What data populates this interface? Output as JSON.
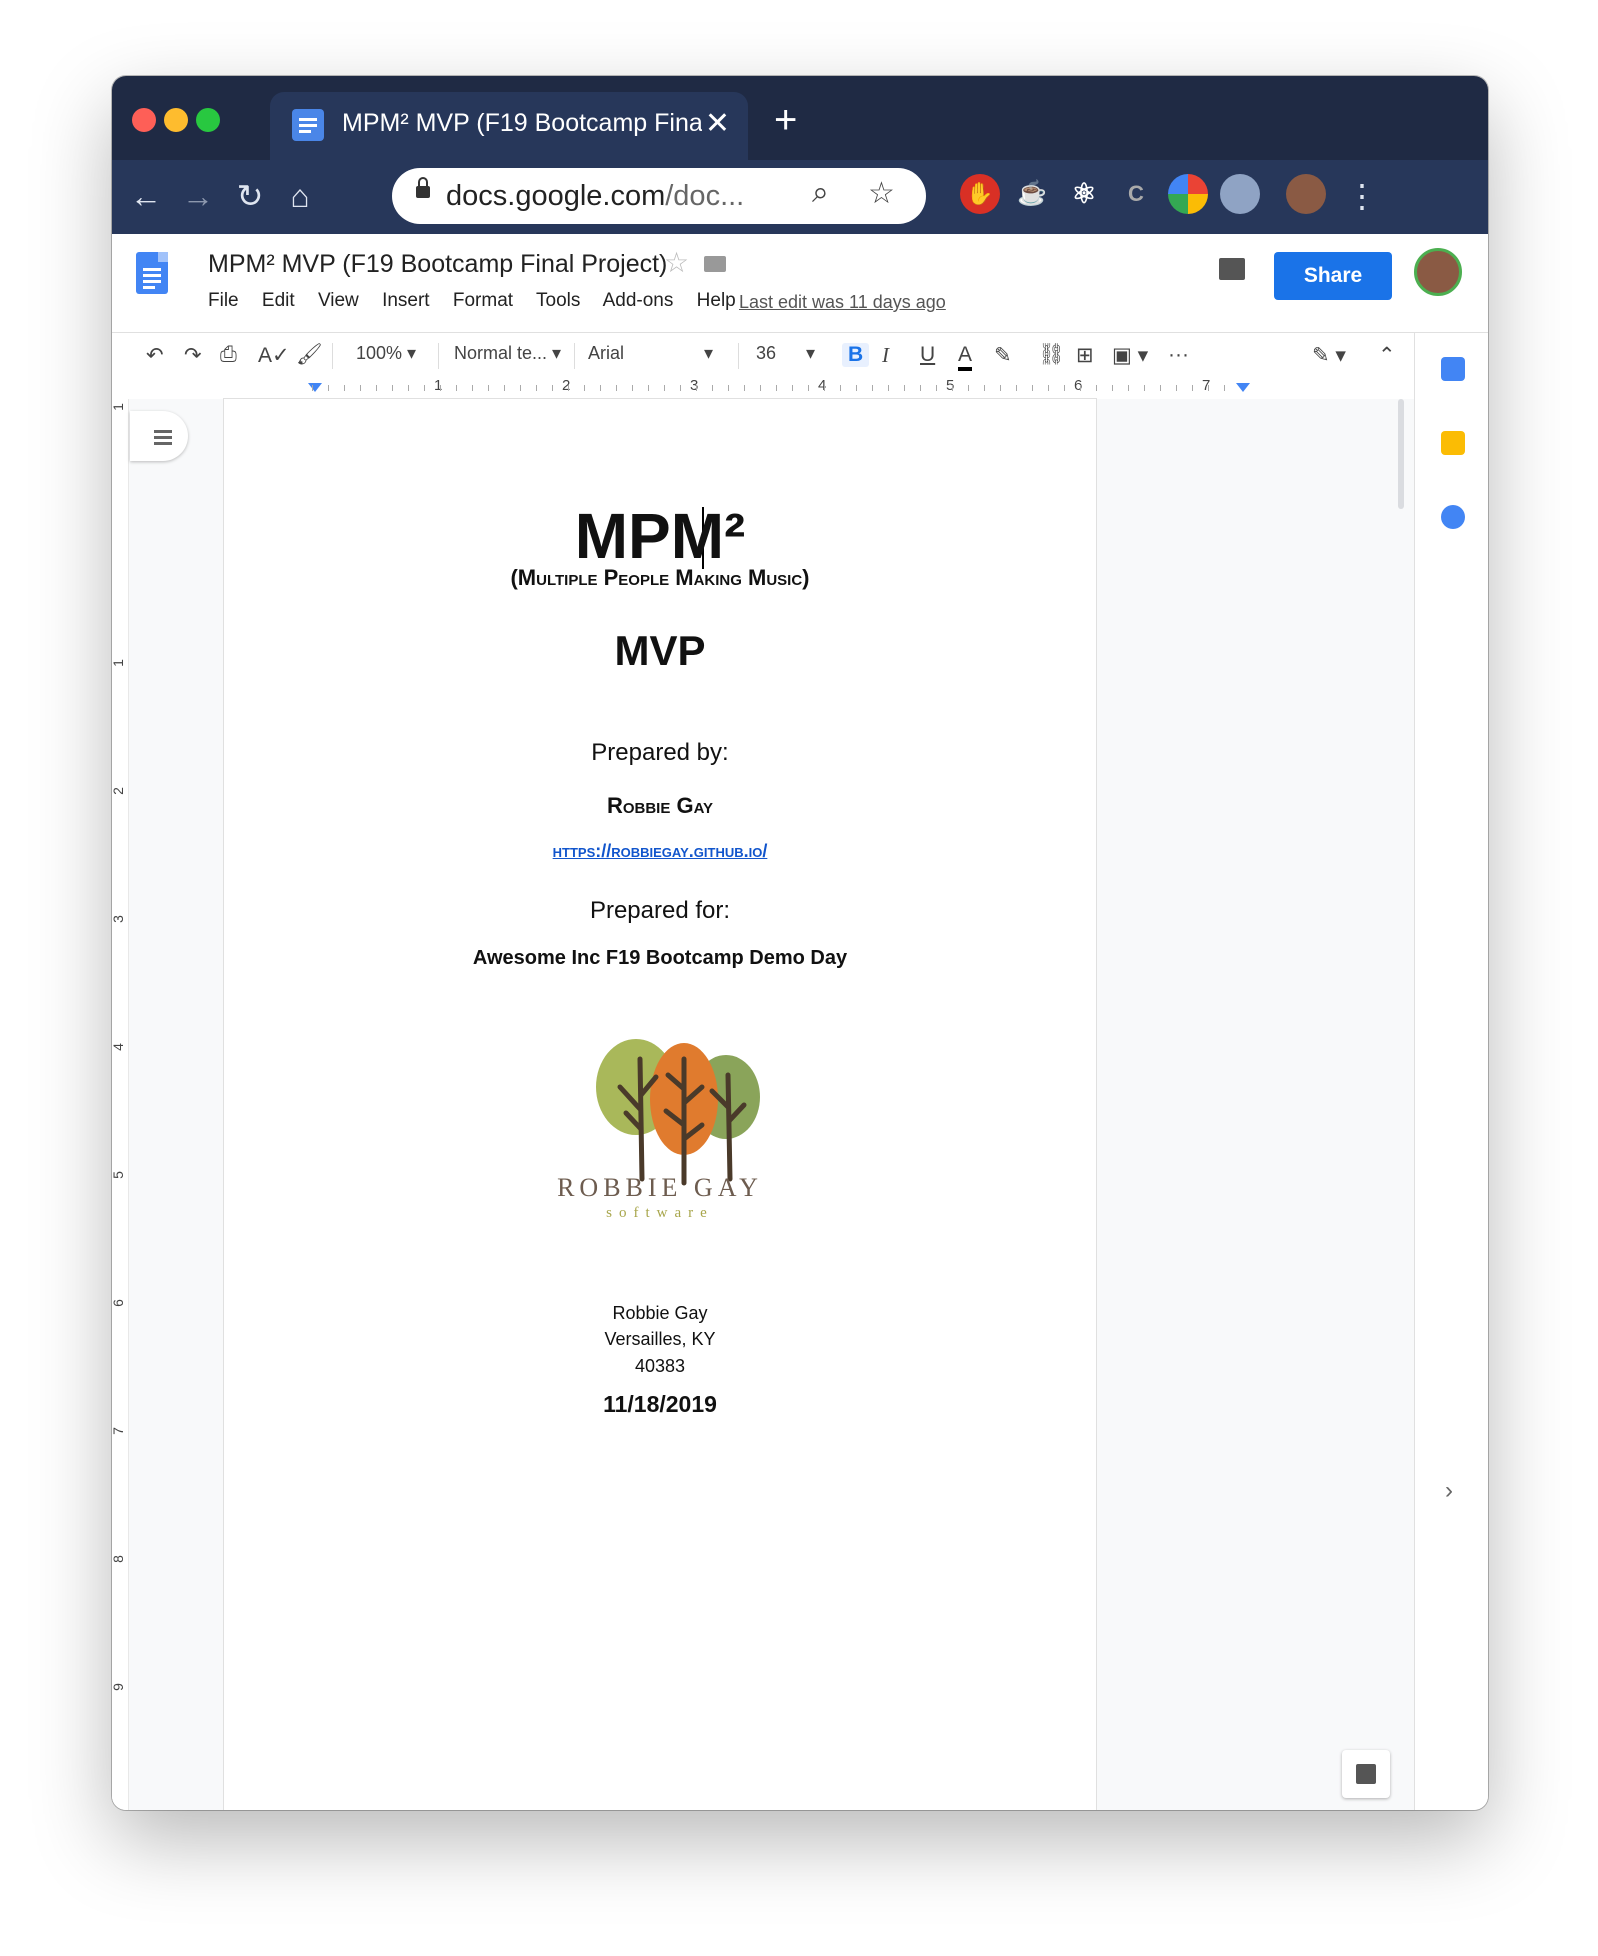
{
  "browser": {
    "tab_title": "MPM² MVP (F19 Bootcamp Fina",
    "tab_close": "✕",
    "new_tab": "+",
    "url_main": "docs.google.com",
    "url_rest": "/doc...",
    "nav": {
      "back": "←",
      "forward": "→",
      "reload": "↻",
      "home": "⌂",
      "menu": "⋮"
    }
  },
  "docs": {
    "title": "MPM² MVP (F19 Bootcamp Final Project)",
    "menu": [
      "File",
      "Edit",
      "View",
      "Insert",
      "Format",
      "Tools",
      "Add-ons",
      "Help"
    ],
    "last_edit": "Last edit was 11 days ago",
    "share_label": "Share"
  },
  "toolbar": {
    "zoom": "100%",
    "style": "Normal te...",
    "font": "Arial",
    "size": "36",
    "bold": "B",
    "italic": "I",
    "underline": "U",
    "text_color": "A",
    "more": "···"
  },
  "ruler": {
    "numbers": [
      "1",
      "2",
      "3",
      "4",
      "5",
      "6",
      "7"
    ],
    "vnumbers": [
      "1",
      "1",
      "2",
      "3",
      "4",
      "5",
      "6",
      "7",
      "8",
      "9"
    ]
  },
  "document": {
    "title": "MPM²",
    "subtitle": "(Multiple People Making Music)",
    "mvp": "MVP",
    "prepared_by_label": "Prepared by:",
    "author": "Robbie Gay",
    "url": "https://robbiegay.github.io/",
    "prepared_for_label": "Prepared for:",
    "event": "Awesome Inc F19 Bootcamp Demo Day",
    "logo_text": "ROBBIE GAY",
    "logo_sub": "software",
    "address": [
      "Robbie Gay",
      "Versailles, KY",
      "40383"
    ],
    "date": "11/18/2019"
  },
  "colors": {
    "chrome_dark": "#1f2a44",
    "chrome_toolbar": "#27375a",
    "share_blue": "#1a73e8",
    "link_blue": "#1155cc"
  }
}
